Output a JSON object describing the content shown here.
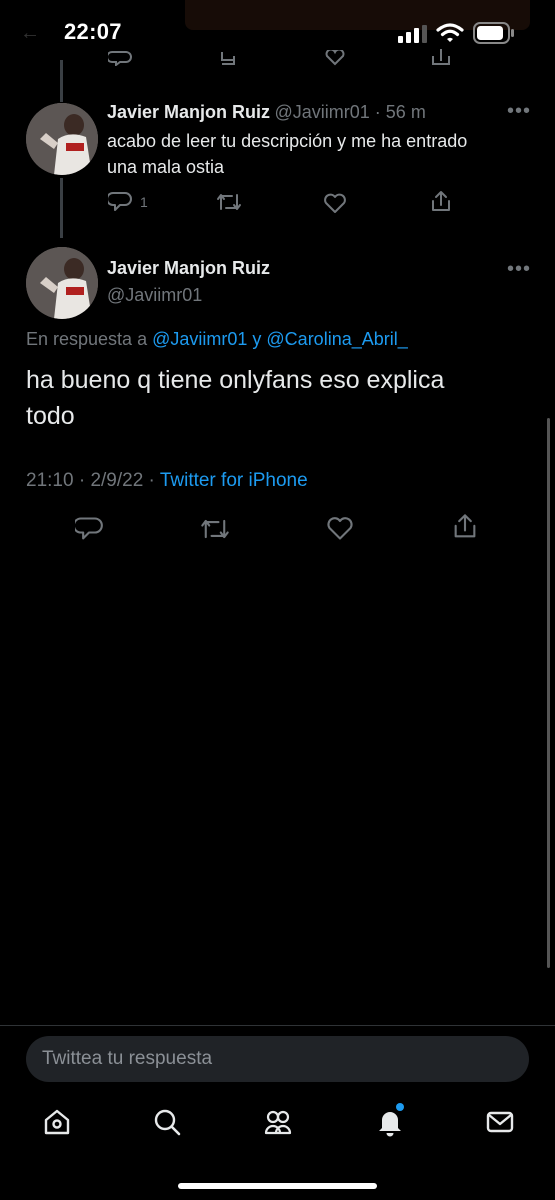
{
  "status_bar": {
    "time": "22:07"
  },
  "tweets": [
    {
      "name": "Javier Manjon Ruiz",
      "handle": "@Javiimr01",
      "time_ago": "56 m",
      "text_line1": "acabo de leer tu descripción y me ha entrado",
      "text_line2": "una mala ostia",
      "reply_count": "1"
    }
  ],
  "main_tweet": {
    "name": "Javier Manjon Ruiz",
    "handle": "@Javiimr01",
    "reply_prefix": "En respuesta a ",
    "mention1": "@Javiimr01",
    "reply_joiner": " y ",
    "mention2": "@Carolina_Abril_",
    "text_line1": "ha bueno q tiene onlyfans eso explica",
    "text_line2": "todo",
    "time": "21:10",
    "date": "2/9/22",
    "source": "Twitter for iPhone"
  },
  "compose": {
    "placeholder": "Twittea tu respuesta"
  },
  "tabbar": {
    "items": [
      {
        "icon": "home-icon"
      },
      {
        "icon": "search-icon"
      },
      {
        "icon": "communities-icon"
      },
      {
        "icon": "notifications-icon"
      },
      {
        "icon": "messages-icon"
      }
    ]
  },
  "colors": {
    "accent": "#1d9bf0",
    "background": "#000000",
    "muted": "#71767b"
  }
}
